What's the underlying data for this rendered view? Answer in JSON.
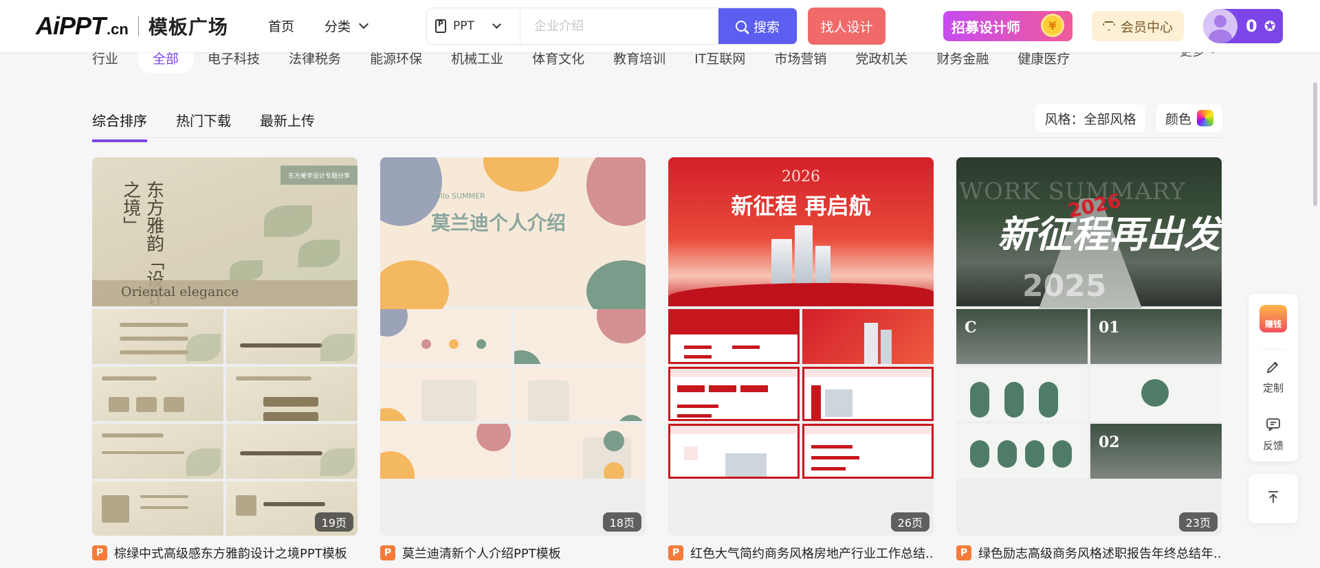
{
  "header": {
    "logo_main": "AiPPT",
    "logo_sub": ".cn",
    "logo_cn": "模板广场",
    "nav_home": "首页",
    "nav_category": "分类",
    "search_type": "PPT",
    "search_placeholder": "企业介绍",
    "search_button": "搜索",
    "find_designer": "找人设计",
    "recruit": "招募设计师",
    "recruit_coin": "¥",
    "vip": "会员中心",
    "user_count": "0"
  },
  "industry": {
    "label": "行业",
    "active": "全部",
    "items": [
      "电子科技",
      "法律税务",
      "能源环保",
      "机械工业",
      "体育文化",
      "教育培训",
      "IT互联网",
      "市场营销",
      "党政机关",
      "财务金融",
      "健康医疗"
    ],
    "more": "更多"
  },
  "sort_tabs": [
    "综合排序",
    "热门下载",
    "最新上传"
  ],
  "filters": {
    "style": "风格：全部风格",
    "color": "颜色"
  },
  "cards": [
    {
      "title": "棕绿中式高级感东方雅韵设计之境PPT模板",
      "pages": "19页",
      "hero_vertical": "东方雅韵「设计之境」",
      "hero_tag": "东方美学设计专题分享",
      "hero_english": "Oriental elegance",
      "accent": "#b9ac8e"
    },
    {
      "title": "莫兰迪清新个人介绍PPT模板",
      "pages": "18页",
      "hero_hello": "hello SUMMER",
      "hero_title": "莫兰迪个人介绍",
      "accent": "#8aa69e"
    },
    {
      "title": "红色大气简约商务风格房地产行业工作总结...",
      "pages": "26页",
      "hero_year": "2026",
      "hero_title": "新征程 再启航",
      "accent": "#c8161e"
    },
    {
      "title": "绿色励志高级商务风格述职报告年终总结年...",
      "pages": "23页",
      "hero_watermark": "WORK SUMMARY",
      "hero_title": "新征程再出发",
      "hero_year": "2026",
      "hero_year2": "2025",
      "accent": "#4f7c68"
    }
  ],
  "float_toolbar": {
    "earn": "赚钱",
    "custom": "定制",
    "feedback": "反馈"
  },
  "colors": {
    "brand": "#7b45e8",
    "search_button": "#5b5ef1",
    "designer_button": "#f16a6a"
  }
}
